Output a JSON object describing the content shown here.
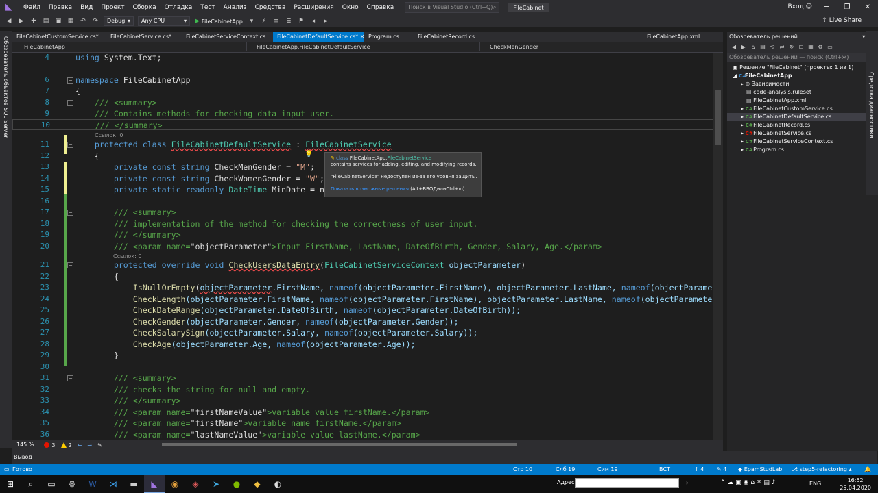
{
  "window": {
    "menu": [
      "Файл",
      "Правка",
      "Вид",
      "Проект",
      "Сборка",
      "Отладка",
      "Тест",
      "Анализ",
      "Средства",
      "Расширения",
      "Окно",
      "Справка"
    ],
    "search_placeholder": "Поиск в Visual Studio (Ctrl+Q)",
    "solution_name": "FileCabinet",
    "login": "Вход",
    "live_share": "Live Share"
  },
  "toolbar": {
    "config": "Debug",
    "platform": "Any CPU",
    "start": "FileCabinetApp"
  },
  "left_strip": {
    "sql_server": "Обозреватель объектов SQL Server"
  },
  "tabs": [
    {
      "label": "FileCabinetCustomService.cs*"
    },
    {
      "label": "FileCabinetService.cs*"
    },
    {
      "label": "FileCabinetServiceContext.cs"
    },
    {
      "label": "FileCabinetDefaultService.cs*",
      "close": "✕"
    },
    {
      "label": "Program.cs"
    },
    {
      "label": "FileCabinetRecord.cs"
    },
    {
      "label": "FileCabinetApp.xml"
    }
  ],
  "navbar": {
    "project": "FileCabinetApp",
    "type": "FileCabinetApp.FileCabinetDefaultService",
    "member": "CheckMenGender"
  },
  "code": {
    "l4": "4",
    "l4_using": "using",
    "l4_rest": " System.Text;",
    "l6": "6",
    "l6_ns": "namespace",
    "l6_name": " FileCabinetApp",
    "l7": "7",
    "l7_text": "{",
    "l8": "8",
    "l8_text": "    /// <summary>",
    "l9": "9",
    "l9_text": "    /// Contains methods for checking data input user.",
    "l10": "10",
    "l10_text": "    /// </summary>",
    "refs1": "Ссылок: 0",
    "l11": "11",
    "l11_kw": "    protected class ",
    "l11_name": "FileCabinetDefaultService",
    "l11_colon": " : ",
    "l11_base": "FileCabinetService",
    "l12": "12",
    "l12_text": "    {",
    "l13": "13",
    "l13_kw": "        private const string ",
    "l13_id": "CheckMenGender = ",
    "l13_str": "\"M\"",
    "l13_end": ";",
    "l14": "14",
    "l14_kw": "        private const string ",
    "l14_id": "CheckWomenGender = ",
    "l14_str": "\"W\"",
    "l14_end": ";",
    "l15": "15",
    "l15_kw": "        private static readonly ",
    "l15_ty": "DateTime",
    "l15_id": " MinDate = ne",
    "l16": "16",
    "l17": "17",
    "l17_text": "        /// <summary>",
    "l18": "18",
    "l18_text": "        /// implementation of the method for checking the correctness of user input.",
    "l19": "19",
    "l19_text": "        /// </summary>",
    "l20": "20",
    "l20_a": "        /// <param name=",
    "l20_b": "\"objectParameter\"",
    "l20_c": ">Input FirstName, LastName, DateOfBirth, Gender, Salary, Age.</param>",
    "refs2": "Ссылок: 0",
    "l21": "21",
    "l21_kw": "        protected override void ",
    "l21_name": "CheckUsersDataEntry",
    "l21_p": "(",
    "l21_ty": "FileCabinetServiceContext",
    "l21_arg": " objectParameter",
    "l21_end": ")",
    "l22": "22",
    "l22_text": "        {",
    "l23": "23",
    "l23_m": "            IsNullOrEmpty",
    "l23_a": "(",
    "l23_p": "objectParameter",
    "l23_b": ".FirstName, ",
    "l23_n": "nameof",
    "l23_c": "(objectParameter.FirstName), objectParameter.LastName, ",
    "l23_n2": "nameof",
    "l23_d": "(objectParamete",
    "l24": "24",
    "l24_m": "            CheckLength",
    "l24_a": "(objectParameter.FirstName, ",
    "l24_n": "nameof",
    "l24_b": "(objectParameter.FirstName), objectParameter.LastName, ",
    "l24_n2": "nameof",
    "l24_c": "(objectParameter.",
    "l25": "25",
    "l25_m": "            CheckDateRange",
    "l25_a": "(objectParameter.DateOfBirth, ",
    "l25_n": "nameof",
    "l25_b": "(objectParameter.DateOfBirth));",
    "l26": "26",
    "l26_m": "            CheckGender",
    "l26_a": "(objectParameter.Gender, ",
    "l26_n": "nameof",
    "l26_b": "(objectParameter.Gender));",
    "l27": "27",
    "l27_m": "            CheckSalarySign",
    "l27_a": "(objectParameter.Salary, ",
    "l27_n": "nameof",
    "l27_b": "(objectParameter.Salary));",
    "l28": "28",
    "l28_m": "            CheckAge",
    "l28_a": "(objectParameter.Age, ",
    "l28_n": "nameof",
    "l28_b": "(objectParameter.Age));",
    "l29": "29",
    "l29_text": "        }",
    "l30": "30",
    "l31": "31",
    "l31_text": "        /// <summary>",
    "l32": "32",
    "l32_text": "        /// checks the string for null and empty.",
    "l33": "33",
    "l33_text": "        /// </summary>",
    "l34": "34",
    "l34_a": "        /// <param name=",
    "l34_b": "\"firstNameValue\"",
    "l34_c": ">variable value firstName.</param>",
    "l35": "35",
    "l35_a": "        /// <param name=",
    "l35_b": "\"firstName\"",
    "l35_c": ">variable name firstName.</param>",
    "l36": "36",
    "l36_a": "        /// <param name=",
    "l36_b": "\"lastNameValue\"",
    "l36_c": ">variable value lastName.</param>"
  },
  "tooltip": {
    "kind": "class",
    "ns": "FileCabinetApp.",
    "name": "FileCabinetService",
    "desc": "contains services for adding, editing, and modifying records.",
    "error": "\"FileCabinetService\" недоступен из-за его уровня защиты.",
    "link": "Показать возможные решения",
    "shortcut": "(Alt+ВВОДилиCtrl+ю)"
  },
  "editor_status": {
    "zoom": "145 %",
    "errors": "3",
    "warnings": "2"
  },
  "output": {
    "title": "Вывод"
  },
  "solution_explorer": {
    "title": "Обозреватель решений",
    "search": "Обозреватель решений — поиск (Ctrl+ж)",
    "solution": "Решение \"FileCabinet\" (проекты: 1 из 1)",
    "project": "FileCabinetApp",
    "items": [
      "Зависимости",
      "code-analysis.ruleset",
      "FileCabinetApp.xml",
      "FileCabinetCustomService.cs",
      "FileCabinetDefaultService.cs",
      "FileCabinetRecord.cs",
      "FileCabinetService.cs",
      "FileCabinetServiceContext.cs",
      "Program.cs"
    ]
  },
  "right_strip": {
    "diagnostics": "Средства диагностики"
  },
  "statusbar": {
    "ready": "Готово",
    "line": "Стр 10",
    "col": "Слб 19",
    "ch": "Сим 19",
    "mode": "ВСТ",
    "up": "4",
    "edits": "4",
    "repo": "EpamStudLab",
    "branch": "step5-refactoring"
  },
  "taskbar": {
    "address": "Адрес",
    "lang": "ENG",
    "time": "16:52",
    "date": "25.04.2020"
  },
  "colors": {
    "accent": "#007acc",
    "keyword": "#569cd6",
    "type": "#4ec9b0",
    "comment": "#57a64a",
    "string": "#d69d85"
  }
}
